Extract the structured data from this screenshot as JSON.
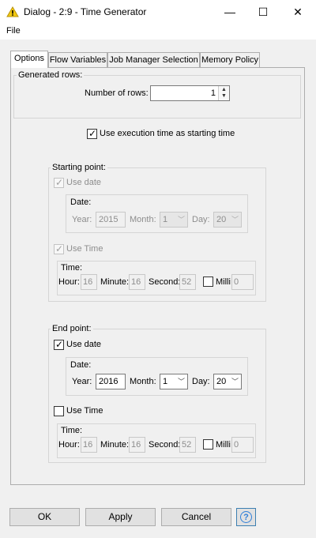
{
  "window": {
    "title": "Dialog - 2:9 - Time Generator",
    "minimize": "—",
    "maximize": "☐",
    "close": "✕"
  },
  "menu": {
    "file": "File"
  },
  "tabs": [
    "Options",
    "Flow Variables",
    "Job Manager Selection",
    "Memory Policy"
  ],
  "generated_rows": {
    "title": "Generated rows:",
    "number_of_rows_label": "Number of rows:",
    "number_of_rows_value": "1"
  },
  "use_execution_time": {
    "label": "Use execution time as starting time",
    "checked": true
  },
  "starting_point": {
    "title": "Starting point:",
    "use_date_label": "Use date",
    "date_title": "Date:",
    "year_label": "Year:",
    "year_value": "2015",
    "month_label": "Month:",
    "month_value": "1",
    "day_label": "Day:",
    "day_value": "20",
    "use_time_label": "Use Time",
    "time_title": "Time:",
    "hour_label": "Hour:",
    "hour_value": "16",
    "minute_label": "Minute:",
    "minute_value": "16",
    "second_label": "Second:",
    "second_value": "52",
    "milli_label": "Milli:",
    "milli_value": "0"
  },
  "end_point": {
    "title": "End point:",
    "use_date_label": "Use date",
    "date_title": "Date:",
    "year_label": "Year:",
    "year_value": "2016",
    "month_label": "Month:",
    "month_value": "1",
    "day_label": "Day:",
    "day_value": "20",
    "use_time_label": "Use Time",
    "time_title": "Time:",
    "hour_label": "Hour:",
    "hour_value": "16",
    "minute_label": "Minute:",
    "minute_value": "16",
    "second_label": "Second:",
    "second_value": "52",
    "milli_label": "Milli:",
    "milli_value": "0"
  },
  "buttons": {
    "ok": "OK",
    "apply": "Apply",
    "cancel": "Cancel",
    "help": "?"
  },
  "colors": {
    "warning_icon": "#f2c811",
    "help_accent": "#2f7fd9"
  }
}
